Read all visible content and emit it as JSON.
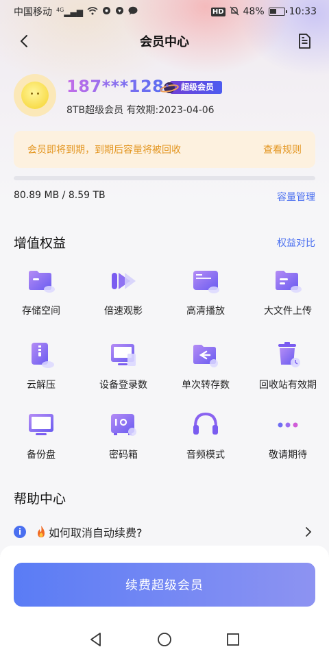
{
  "status_bar": {
    "carrier": "中国移动",
    "network": "4G",
    "hd": "HD",
    "battery": "48%",
    "battery_level": 0.48,
    "time": "10:33"
  },
  "nav": {
    "title": "会员中心"
  },
  "profile": {
    "user_id": "187***128",
    "badge": "超级会员",
    "subline": "8TB超级会员 有效期:2023-04-06"
  },
  "notice": {
    "text": "会员即将到期，到期后容量将被回收",
    "link": "查看规则"
  },
  "storage": {
    "used_text": "80.89 MB / 8.59 TB",
    "used_fraction": 1e-05,
    "manage_link": "容量管理"
  },
  "benefits": {
    "title": "增值权益",
    "compare_link": "权益对比",
    "items": [
      {
        "label": "存储空间",
        "icon": "storage-folder-icon"
      },
      {
        "label": "倍速观影",
        "icon": "speed-play-icon"
      },
      {
        "label": "高清播放",
        "icon": "hd-play-icon"
      },
      {
        "label": "大文件上传",
        "icon": "large-file-upload-icon"
      },
      {
        "label": "云解压",
        "icon": "cloud-unzip-icon"
      },
      {
        "label": "设备登录数",
        "icon": "device-login-icon"
      },
      {
        "label": "单次转存数",
        "icon": "transfer-save-icon"
      },
      {
        "label": "回收站有效期",
        "icon": "recycle-bin-icon"
      },
      {
        "label": "备份盘",
        "icon": "backup-disk-icon"
      },
      {
        "label": "密码箱",
        "icon": "password-safe-icon"
      },
      {
        "label": "音频模式",
        "icon": "headphones-icon"
      },
      {
        "label": "敬请期待",
        "icon": "more-dots-icon"
      }
    ]
  },
  "help": {
    "title": "帮助中心",
    "items": [
      {
        "text": "如何取消自动续费?"
      }
    ]
  },
  "cta": {
    "label": "续费超级会员"
  },
  "colors": {
    "accent": "#4a6ff0",
    "notice_text": "#e3951f",
    "notice_bg": "#fdf1df",
    "icon_purple": "#8a63f0"
  }
}
